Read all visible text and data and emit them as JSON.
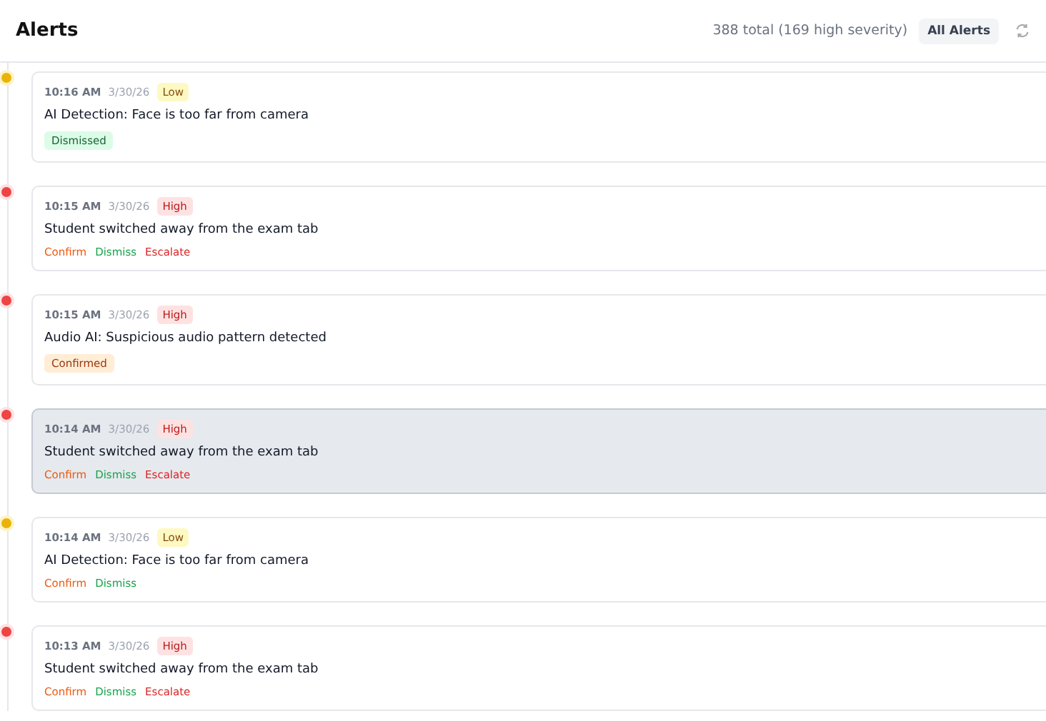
{
  "header": {
    "title": "Alerts",
    "summary": "388 total (169 high severity)",
    "filter_button": "All Alerts"
  },
  "alerts": [
    {
      "time": "10:16 AM",
      "date": "3/30/26",
      "kind": "low",
      "severity_label": "Low",
      "message": "AI Detection: Face is too far from camera",
      "selected": false,
      "status": {
        "kind": "dismissed",
        "label": "Dismissed"
      }
    },
    {
      "time": "10:15 AM",
      "date": "3/30/26",
      "kind": "high",
      "severity_label": "High",
      "message": "Student switched away from the exam tab",
      "selected": false,
      "actions": [
        {
          "kind": "confirm",
          "label": "Confirm"
        },
        {
          "kind": "dismiss",
          "label": "Dismiss"
        },
        {
          "kind": "escalate",
          "label": "Escalate"
        }
      ]
    },
    {
      "time": "10:15 AM",
      "date": "3/30/26",
      "kind": "high",
      "severity_label": "High",
      "message": "Audio AI: Suspicious audio pattern detected",
      "selected": false,
      "status": {
        "kind": "confirmed",
        "label": "Confirmed"
      }
    },
    {
      "time": "10:14 AM",
      "date": "3/30/26",
      "kind": "high",
      "severity_label": "High",
      "message": "Student switched away from the exam tab",
      "selected": true,
      "actions": [
        {
          "kind": "confirm",
          "label": "Confirm"
        },
        {
          "kind": "dismiss",
          "label": "Dismiss"
        },
        {
          "kind": "escalate",
          "label": "Escalate"
        }
      ]
    },
    {
      "time": "10:14 AM",
      "date": "3/30/26",
      "kind": "low",
      "severity_label": "Low",
      "message": "AI Detection: Face is too far from camera",
      "selected": false,
      "actions": [
        {
          "kind": "confirm",
          "label": "Confirm"
        },
        {
          "kind": "dismiss",
          "label": "Dismiss"
        }
      ]
    },
    {
      "time": "10:13 AM",
      "date": "3/30/26",
      "kind": "high",
      "severity_label": "High",
      "message": "Student switched away from the exam tab",
      "selected": false,
      "actions": [
        {
          "kind": "confirm",
          "label": "Confirm"
        },
        {
          "kind": "dismiss",
          "label": "Dismiss"
        },
        {
          "kind": "escalate",
          "label": "Escalate"
        }
      ]
    }
  ]
}
